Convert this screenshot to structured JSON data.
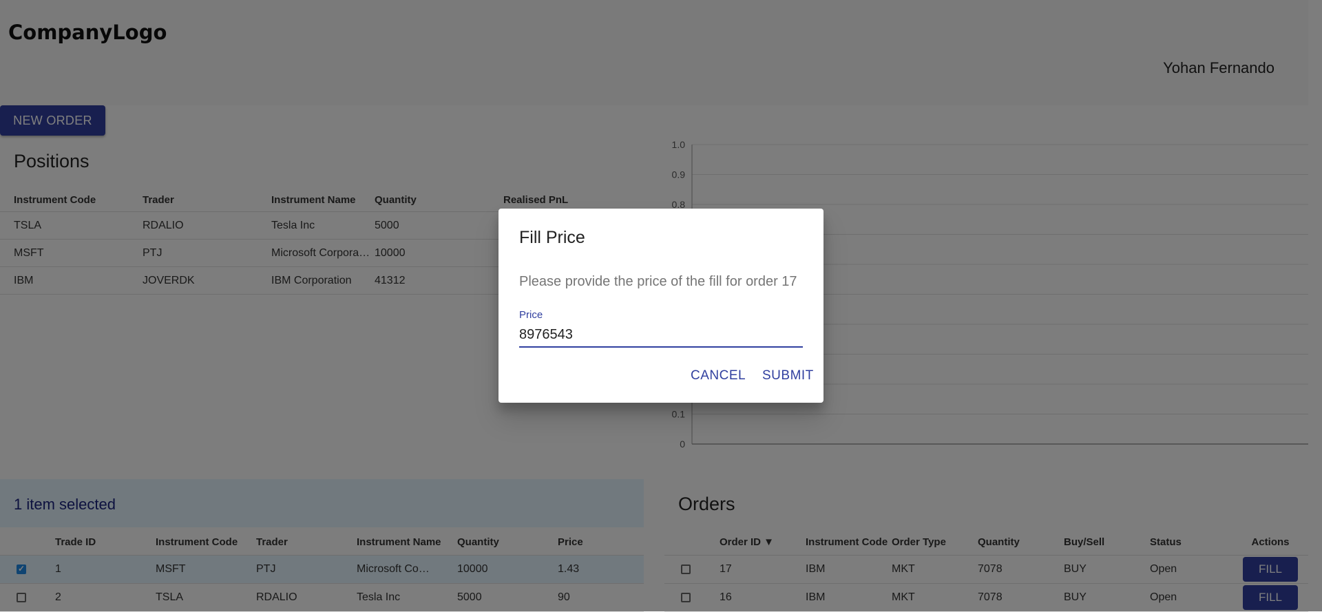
{
  "header": {
    "logo": "CompanyLogo",
    "user": "Yohan Fernando"
  },
  "toolbar": {
    "new_order_label": "NEW ORDER"
  },
  "positions": {
    "title": "Positions",
    "columns": [
      "Instrument Code",
      "Trader",
      "Instrument Name",
      "Quantity",
      "Realised PnL"
    ],
    "rows": [
      [
        "TSLA",
        "RDALIO",
        "Tesla Inc",
        "5000",
        ""
      ],
      [
        "MSFT",
        "PTJ",
        "Microsoft Corpora…",
        "10000",
        ""
      ],
      [
        "IBM",
        "JOVERDK",
        "IBM Corporation",
        "41312",
        ""
      ]
    ]
  },
  "chart_data": {
    "type": "bar",
    "categories": [],
    "values": [],
    "ylim": [
      0,
      1.0
    ],
    "yticks": [
      "0",
      "0.1",
      "0.2",
      "0.3",
      "0.4",
      "0.5",
      "0.6",
      "0.7",
      "0.8",
      "0.9",
      "1.0"
    ],
    "visible_yticks": [
      "1.0",
      "0.9",
      "0.8",
      "0.1",
      "0"
    ],
    "grid": true
  },
  "trades": {
    "selection_text": "1 item selected",
    "columns": [
      "Trade ID",
      "Instrument Code",
      "Trader",
      "Instrument Name",
      "Quantity",
      "Price"
    ],
    "rows": [
      {
        "checked": true,
        "cells": [
          "1",
          "MSFT",
          "PTJ",
          "Microsoft Co…",
          "10000",
          "1.43"
        ]
      },
      {
        "checked": false,
        "cells": [
          "2",
          "TSLA",
          "RDALIO",
          "Tesla Inc",
          "5000",
          "90"
        ]
      }
    ]
  },
  "orders": {
    "title": "Orders",
    "columns": [
      "Order ID ▼",
      "Instrument Code",
      "Order Type",
      "Quantity",
      "Buy/Sell",
      "Status",
      "Actions"
    ],
    "rows": [
      {
        "cells": [
          "17",
          "IBM",
          "MKT",
          "7078",
          "BUY",
          "Open"
        ],
        "action": "FILL"
      },
      {
        "cells": [
          "16",
          "IBM",
          "MKT",
          "7078",
          "BUY",
          "Open"
        ],
        "action": "FILL"
      }
    ]
  },
  "dialog": {
    "title": "Fill Price",
    "text": "Please provide the price of the fill for order 17",
    "field_label": "Price",
    "field_value": "8976543",
    "cancel_label": "CANCEL",
    "submit_label": "SUBMIT"
  },
  "colors": {
    "primary": "#303f9f",
    "selection_bg": "#e3f2fd"
  }
}
